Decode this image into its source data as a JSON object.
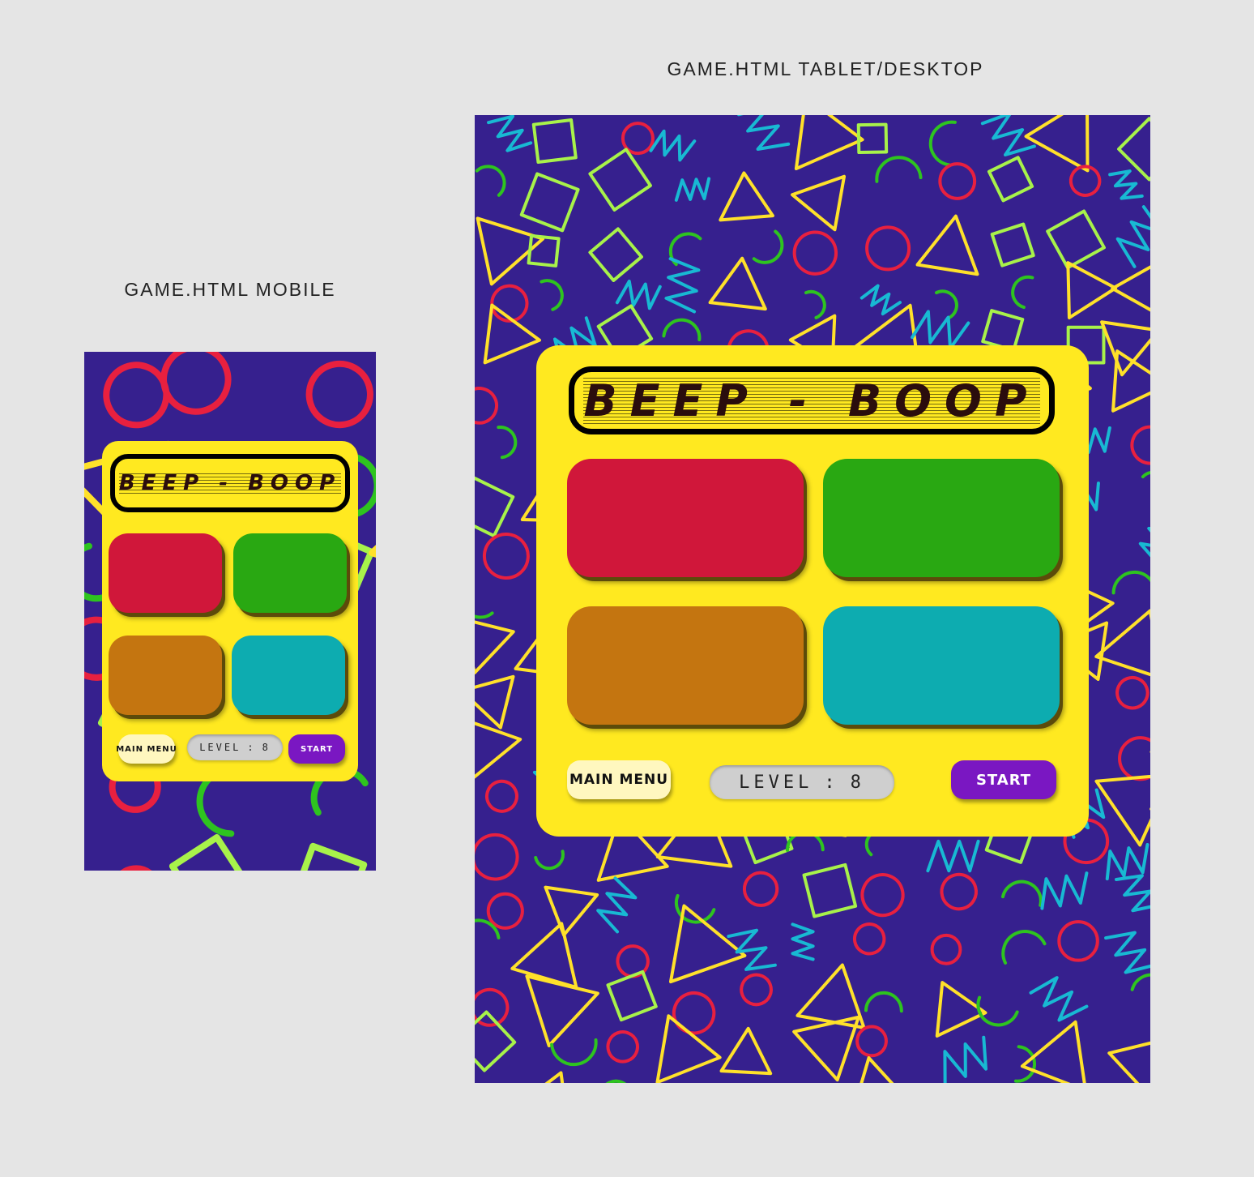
{
  "captions": {
    "mobile": "GAME.HTML MOBILE",
    "desktop": "GAME.HTML TABLET/DESKTOP"
  },
  "game": {
    "title": "BEEP - BOOP",
    "main_menu_label": "MAIN MENU",
    "level_label": "LEVEL",
    "level_separator": ":",
    "level_value": "8",
    "start_label": "START"
  },
  "colors": {
    "background": "#36208e",
    "panel": "#ffe920",
    "pad_red": "#d0173a",
    "pad_green": "#29a812",
    "pad_orange": "#c47510",
    "pad_teal": "#0dacb0",
    "start_button": "#7a17c2",
    "menu_button": "#fff7bf",
    "level_display": "#cfcfcf",
    "pattern_yellow": "#ffe12a",
    "pattern_lime": "#a8f24a",
    "pattern_green": "#2ec41f",
    "pattern_cyan": "#18b9d3",
    "pattern_red": "#e8203f"
  }
}
